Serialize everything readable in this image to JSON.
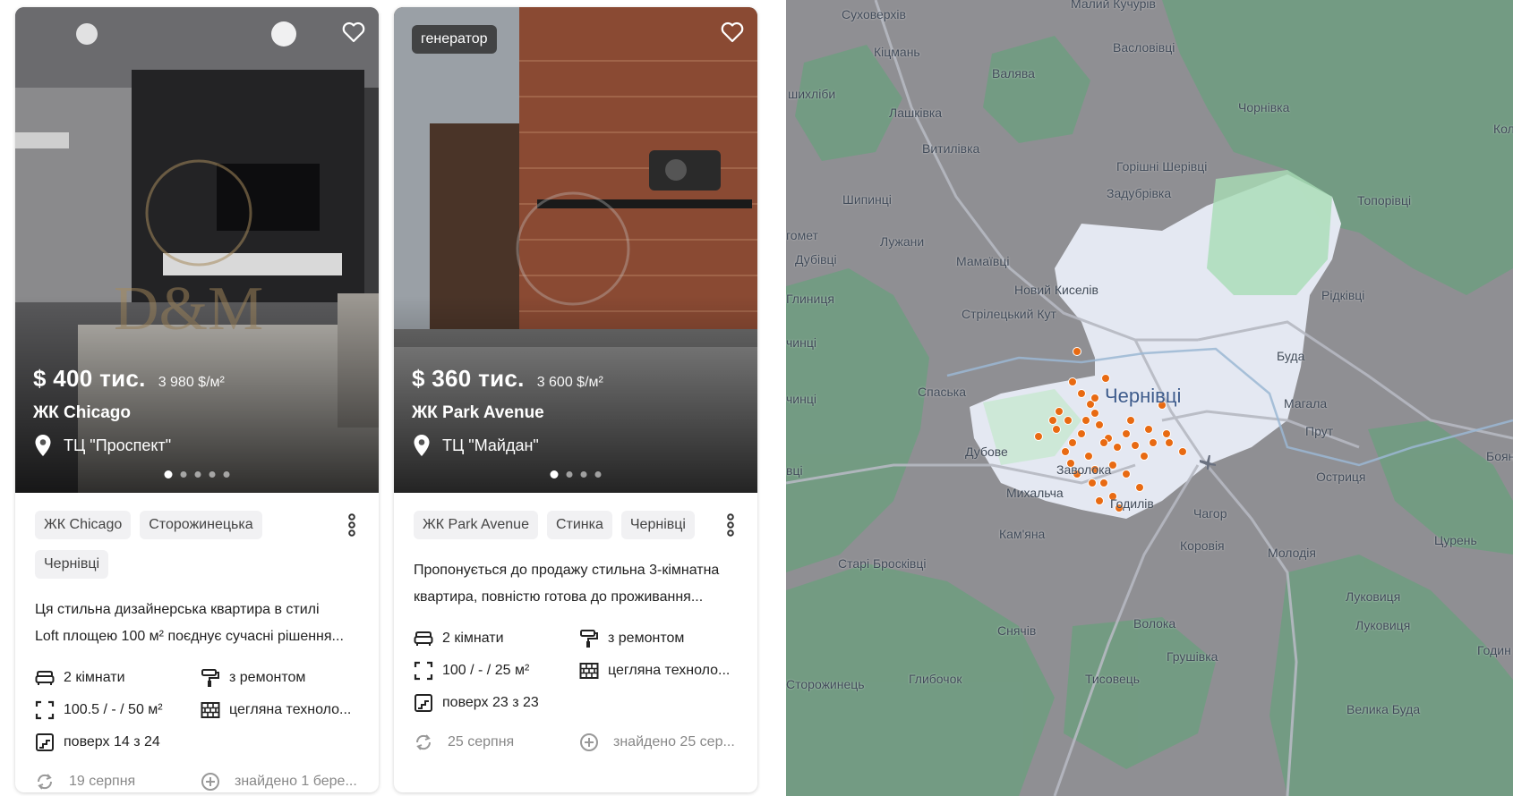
{
  "listings": [
    {
      "tag": "",
      "price": "$ 400 тис.",
      "price_per_m2": "3 980 $/м²",
      "complex": "ЖК Chicago",
      "landmark": "ТЦ \"Проспект\"",
      "photo_count": 5,
      "photo_active": 1,
      "chips": [
        "ЖК Chicago",
        "Сторожинецька",
        "Чернівці"
      ],
      "description_line1": "Ця стильна дизайнерська квартира в стилі",
      "description_line2": "Loft площею 100 м² поєднує сучасні рішення...",
      "rooms": "2 кімнати",
      "renovation": "з ремонтом",
      "area": "100.5 / - / 50 м²",
      "technology": "цегляна техноло...",
      "floor": "поверх 14 з 24",
      "date": "19 серпня",
      "found": "знайдено 1 бере..."
    },
    {
      "tag": "генератор",
      "price": "$ 360 тис.",
      "price_per_m2": "3 600 $/м²",
      "complex": "ЖК Park Avenue",
      "landmark": "ТЦ \"Майдан\"",
      "photo_count": 4,
      "photo_active": 1,
      "chips": [
        "ЖК Park Avenue",
        "Стинка",
        "Чернівці"
      ],
      "description_line1": "Пропонується до продажу стильна 3-кімнатна",
      "description_line2": "квартира, повністю готова до проживання...",
      "rooms": "2 кімнати",
      "renovation": "з ремонтом",
      "area": "100 / - / 25 м²",
      "technology": "цегляна техноло...",
      "floor": "поверх 23 з 23",
      "date": "25 серпня",
      "found": "знайдено 25 сер..."
    }
  ],
  "map": {
    "city": "Чернівці",
    "labels": {
      "sukhoverkhiv": "Суховерхів",
      "malyi_kuchuriv": "Малий Кучурів",
      "kitsman": "Кіцмань",
      "vasylivtsi": "Васловівці",
      "valyava": "Валява",
      "shykhlibi": "шихліби",
      "lashkivka": "Лашківка",
      "chornivka": "Чорнівка",
      "vytylivka": "Витилівка",
      "horishni_sherivtsi": "Горішні Шерівці",
      "zadubrivka": "Задубрівка",
      "shypyntsi": "Шипинці",
      "topoorivtsi": "Топорівці",
      "luzhany": "Лужани",
      "hlomet": "гомет",
      "dubivtsi": "Дубівці",
      "mamaivtsi": "Мамаївці",
      "novyi_kyselyv": "Новий Киселів",
      "rydkivtsi": "Рідківці",
      "hlynytsia": "Глиниця",
      "striletskyi_kut": "Стрілецький Кут",
      "chyntsi1": "чинці",
      "buda": "Буда",
      "spaska": "Спаська",
      "chyntsi2": "чинці",
      "mahala": "Магала",
      "prut": "Прут",
      "dubove": "Дубове",
      "zavoloka": "Заволока",
      "ostrytsia": "Остриця",
      "boiany": "Бояни",
      "mykhalcha": "Михальча",
      "hodyliv": "Годилів",
      "chahor": "Чагор",
      "kamiana": "Кам'яна",
      "kolinkivtsi": "Колі",
      "korovia": "Коровія",
      "tsuren": "Цурень",
      "stari_broskivtsi": "Старі Бросківці",
      "molodia": "Молодія",
      "lukovytsia": "Луковиця",
      "lukovytsia2": "Луковиця",
      "volaka": "Волока",
      "hodynivka": "Годин",
      "snyachiv": "Снячів",
      "hrushivka": "Грушівка",
      "storozhynets": "Сторожинець",
      "hlyboka": "Глибочок",
      "tysovets": "Тисовець",
      "velyka_buda": "Велика Буда",
      "vtsi": "вці"
    }
  }
}
